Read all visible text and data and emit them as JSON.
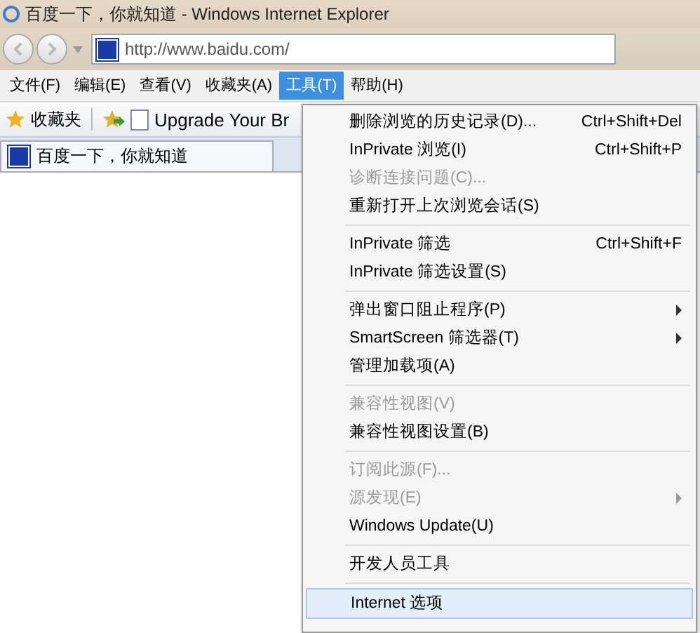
{
  "window": {
    "title": "百度一下，你就知道 - Windows Internet Explorer"
  },
  "address_bar": {
    "url": "http://www.baidu.com/"
  },
  "menu_bar": [
    {
      "label": "文件(F)",
      "selected": false
    },
    {
      "label": "编辑(E)",
      "selected": false
    },
    {
      "label": "查看(V)",
      "selected": false
    },
    {
      "label": "收藏夹(A)",
      "selected": false
    },
    {
      "label": "工具(T)",
      "selected": true
    },
    {
      "label": "帮助(H)",
      "selected": false
    }
  ],
  "favorites_bar": {
    "favorites": "收藏夹",
    "links": [
      "Upgrade Your Br"
    ]
  },
  "tabs": [
    {
      "label": "百度一下，你就知道",
      "selected": true
    }
  ],
  "tools_menu": [
    {
      "kind": "item",
      "label": "删除浏览的历史记录(D)...",
      "shortcut": "Ctrl+Shift+Del",
      "disabled": false,
      "submenu": false,
      "selected": false
    },
    {
      "kind": "item",
      "label": "InPrivate 浏览(I)",
      "shortcut": "Ctrl+Shift+P",
      "disabled": false,
      "submenu": false,
      "selected": false
    },
    {
      "kind": "item",
      "label": "诊断连接问题(C)...",
      "disabled": true,
      "submenu": false,
      "selected": false
    },
    {
      "kind": "item",
      "label": "重新打开上次浏览会话(S)",
      "disabled": false,
      "submenu": false,
      "selected": false
    },
    {
      "kind": "separator"
    },
    {
      "kind": "item",
      "label": "InPrivate 筛选",
      "shortcut": "Ctrl+Shift+F",
      "disabled": false,
      "submenu": false,
      "selected": false
    },
    {
      "kind": "item",
      "label": "InPrivate 筛选设置(S)",
      "disabled": false,
      "submenu": false,
      "selected": false
    },
    {
      "kind": "separator"
    },
    {
      "kind": "item",
      "label": "弹出窗口阻止程序(P)",
      "disabled": false,
      "submenu": true,
      "selected": false
    },
    {
      "kind": "item",
      "label": "SmartScreen 筛选器(T)",
      "disabled": false,
      "submenu": true,
      "selected": false
    },
    {
      "kind": "item",
      "label": "管理加载项(A)",
      "disabled": false,
      "submenu": false,
      "selected": false
    },
    {
      "kind": "separator"
    },
    {
      "kind": "item",
      "label": "兼容性视图(V)",
      "disabled": true,
      "submenu": false,
      "selected": false
    },
    {
      "kind": "item",
      "label": "兼容性视图设置(B)",
      "disabled": false,
      "submenu": false,
      "selected": false
    },
    {
      "kind": "separator"
    },
    {
      "kind": "item",
      "label": "订阅此源(F)...",
      "disabled": true,
      "submenu": false,
      "selected": false
    },
    {
      "kind": "item",
      "label": "源发现(E)",
      "disabled": true,
      "submenu": true,
      "selected": false
    },
    {
      "kind": "item",
      "label": "Windows Update(U)",
      "disabled": false,
      "submenu": false,
      "selected": false
    },
    {
      "kind": "separator"
    },
    {
      "kind": "item",
      "label": "开发人员工具",
      "disabled": false,
      "submenu": false,
      "selected": false
    },
    {
      "kind": "separator"
    },
    {
      "kind": "item",
      "label": "Internet 选项",
      "disabled": false,
      "submenu": false,
      "selected": true
    }
  ]
}
